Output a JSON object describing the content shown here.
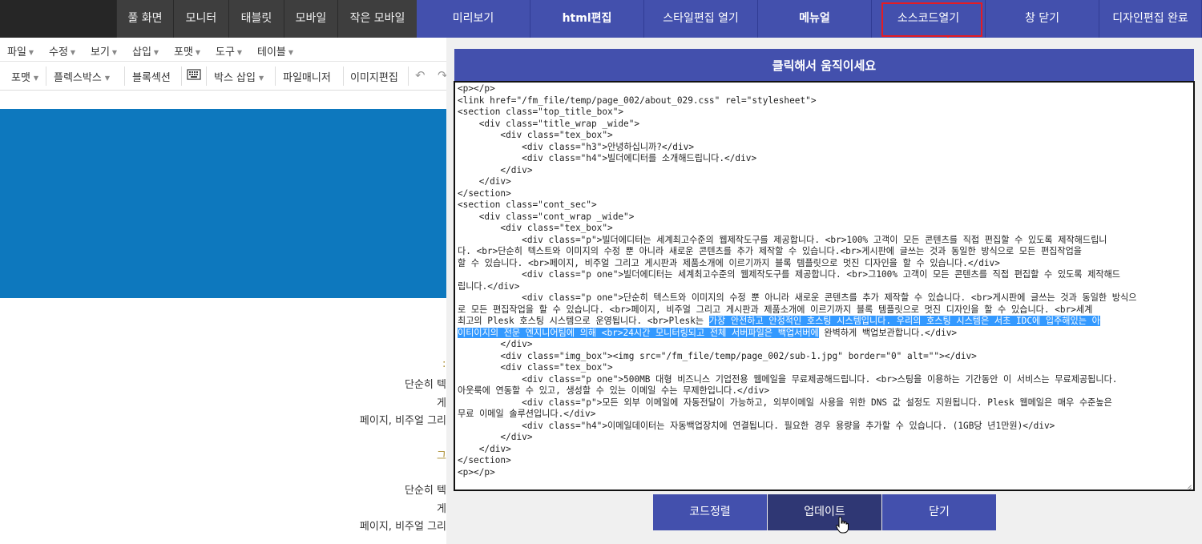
{
  "topbar": {
    "view_modes": [
      "풀 화면",
      "모니터",
      "태블릿",
      "모바일",
      "작은 모바일"
    ],
    "actions": [
      "미리보기",
      "html편집",
      "스타일편집 열기",
      "메뉴얼",
      "소스코드열기",
      "창 닫기",
      "디자인편집 완료"
    ]
  },
  "menubar": {
    "items": [
      "파일",
      "수정",
      "보기",
      "삽입",
      "포맷",
      "도구",
      "테이블"
    ]
  },
  "toolbar": {
    "items": [
      "포맷",
      "플렉스박스",
      "블록섹션",
      "박스 삽입",
      "파일매니저",
      "이미지편집"
    ]
  },
  "page_preview": {
    "lines": [
      "단순히 텍",
      "게",
      "페이지, 비주얼 그리",
      "그",
      "단순히 텍",
      "게",
      "페이지, 비주얼 그리"
    ]
  },
  "dialog": {
    "header": "클릭해서 움직이세요",
    "code_lines": [
      "<p></p>",
      "<link href=\"/fm_file/temp/page_002/about_029.css\" rel=\"stylesheet\">",
      "<section class=\"top_title_box\">",
      "    <div class=\"title_wrap _wide\">",
      "        <div class=\"tex_box\">",
      "            <div class=\"h3\">안녕하십니까?</div>",
      "            <div class=\"h4\">빌더에디터를 소개해드립니다.</div>",
      "        </div>",
      "    </div>",
      "</section>",
      "<section class=\"cont_sec\">",
      "    <div class=\"cont_wrap _wide\">",
      "        <div class=\"tex_box\">",
      "            <div class=\"p\">빌더에디터는 세계최고수준의 웹제작도구를 제공합니다. <br>100% 고객이 모든 콘텐츠를 직접 편집할 수 있도록 제작해드립니",
      "다. <br>단순히 텍스트와 이미지의 수정 뿐 아니라 새로운 콘텐츠를 추가 제작할 수 있습니다.<br>게시판에 글쓰는 것과 동일한 방식으로 모든 편집작업을",
      "할 수 있습니다. <br>페이지, 비주얼 그리고 게시판과 제품소개에 이르기까지 블록 템플릿으로 멋진 디자인을 할 수 있습니다.</div>",
      "            <div class=\"p one\">빌더에디터는 세계최고수준의 웹제작도구를 제공합니다. <br>그100% 고객이 모든 콘텐츠를 직접 편집할 수 있도록 제작해드",
      "립니다.</div>",
      "            <div class=\"p one\">단순히 텍스트와 이미지의 수정 뿐 아니라 새로운 콘텐츠를 추가 제작할 수 있습니다. <br>게시판에 글쓰는 것과 동일한 방식으",
      "로 모든 편집작업을 할 수 있습니다. <br>페이지, 비주얼 그리고 게시판과 제품소개에 이르기까지 블록 템플릿으로 멋진 디자인을 할 수 있습니다. <br>세계",
      "최고의 Plesk 호스팅 시스템으로 운영됩니다. <br>Plesk는 ",
      "",
      "        </div>",
      "        <div class=\"img_box\"><img src=\"/fm_file/temp/page_002/sub-1.jpg\" border=\"0\" alt=\"\"></div>",
      "        <div class=\"tex_box\">",
      "            <div class=\"p one\">500MB 대형 비즈니스 기업전용 웹메일을 무료제공해드립니다. <br>스팅을 이용하는 기간동안 이 서비스는 무료제공됩니다.",
      "아웃룩에 연동할 수 있고, 생성할 수 있는 이메일 수는 무제한입니다.</div>",
      "            <div class=\"p\">모든 외부 이메일에 자동전달이 가능하고, 외부이메일 사용을 위한 DNS 값 설정도 지원됩니다. Plesk 웹메일은 매우 수준높은",
      "무료 이메일 솔루션입니다.</div>",
      "            <div class=\"h4\">이메일데이터는 자동백업장치에 연결됩니다. 필요한 경우 용량을 추가할 수 있습니다. (1GB당 년1만원)</div>",
      "        </div>",
      "    </div>",
      "</section>",
      "<p></p>"
    ],
    "selected_text_line21": "가장 안전하고 안정적인 호스팅 시스템입니다. 우리의 호스팅 시스템은 서초 IDC에 입주해있는 아",
    "selected_text_line22": "이티이지의 전문 엔지니어팀에 의해 <br>24시간 모니터링되고 전체 서버파일은 백업서버에",
    "unselected_tail_line22": " 완벽하게 백업보관합니다.</div>",
    "buttons": {
      "sort": "코드정렬",
      "update": "업데이트",
      "close": "닫기"
    }
  }
}
